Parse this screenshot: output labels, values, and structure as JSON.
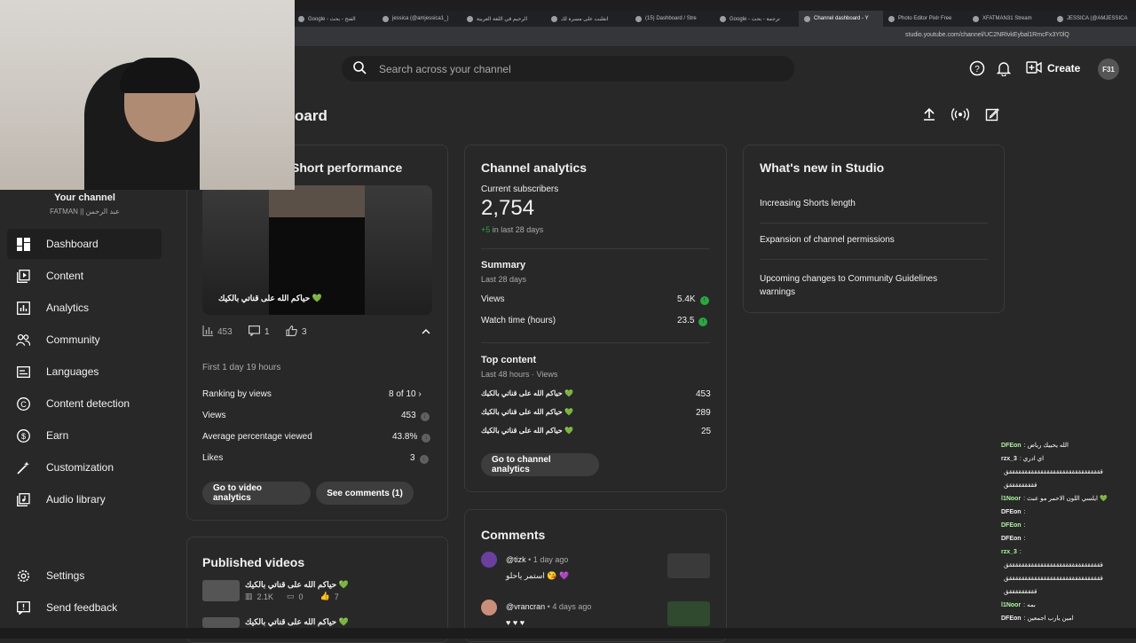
{
  "browser": {
    "tabs": [
      {
        "label": "Google - الفتح - بحث"
      },
      {
        "label": "jessica (@amjessica1_)"
      },
      {
        "label": "الرحيم في اللغة العربية"
      },
      {
        "label": "انقلبت على مسرة لك"
      },
      {
        "label": "(15) Dashboard / Stre"
      },
      {
        "label": "Google - ترجمة - بحث"
      },
      {
        "label": "Channel dashboard - Y",
        "active": true
      },
      {
        "label": "Photo Editor Pixlr Free"
      },
      {
        "label": "XFATMAN31 Stream"
      },
      {
        "label": "JESSICA (@AMJESSICA"
      }
    ],
    "url": "studio.youtube.com/channel/UC2NRlvkEybal1RmcFx3Y0lQ"
  },
  "header": {
    "search_placeholder": "Search across your channel",
    "create_label": "Create",
    "avatar_text": "F31",
    "page_title": "oard"
  },
  "sidebar": {
    "channel_label": "Your channel",
    "channel_name": "FATMAN || عبد الرحمن",
    "items": [
      {
        "label": "Dashboard",
        "icon": "dashboard-icon",
        "active": true
      },
      {
        "label": "Content",
        "icon": "content-icon"
      },
      {
        "label": "Analytics",
        "icon": "analytics-icon"
      },
      {
        "label": "Community",
        "icon": "community-icon"
      },
      {
        "label": "Languages",
        "icon": "languages-icon"
      },
      {
        "label": "Content detection",
        "icon": "content-detection-icon"
      },
      {
        "label": "Earn",
        "icon": "earn-icon"
      },
      {
        "label": "Customization",
        "icon": "customization-icon"
      },
      {
        "label": "Audio library",
        "icon": "audio-library-icon"
      }
    ],
    "settings_label": "Settings",
    "feedback_label": "Send feedback"
  },
  "short_card": {
    "title": "Short performance",
    "thumb_caption": "حياكم الله على قناتي بالكيك 💚",
    "views": "453",
    "comments": "1",
    "likes": "3",
    "first_label": "First 1 day 19 hours",
    "rows": [
      {
        "label": "Ranking by views",
        "value": "8 of 10"
      },
      {
        "label": "Views",
        "value": "453"
      },
      {
        "label": "Average percentage viewed",
        "value": "43.8%"
      },
      {
        "label": "Likes",
        "value": "3"
      }
    ],
    "btn_analytics": "Go to video analytics",
    "btn_comments": "See comments (1)"
  },
  "published": {
    "title": "Published videos",
    "videos": [
      {
        "title": "حياكم الله على قناتي بالكيك 💚",
        "views": "2.1K",
        "comments": "0",
        "likes": "7"
      },
      {
        "title": "حياكم الله على قناتي بالكيك 💚"
      }
    ]
  },
  "analytics_card": {
    "title": "Channel analytics",
    "subs_label": "Current subscribers",
    "subs_value": "2,754",
    "subs_change": "+5",
    "subs_change_suffix": " in last 28 days",
    "summary_title": "Summary",
    "summary_sub": "Last 28 days",
    "summary_rows": [
      {
        "label": "Views",
        "value": "5.4K"
      },
      {
        "label": "Watch time (hours)",
        "value": "23.5"
      }
    ],
    "top_title": "Top content",
    "top_sub": "Last 48 hours · Views",
    "top_rows": [
      {
        "title": "حياكم الله على قناتي بالكيك 💚",
        "value": "453"
      },
      {
        "title": "حياكم الله على قناتي بالكيك 💚",
        "value": "289"
      },
      {
        "title": "حياكم الله على قناتي بالكيك 💚",
        "value": "25"
      }
    ],
    "btn": "Go to channel analytics"
  },
  "comments_card": {
    "title": "Comments",
    "items": [
      {
        "user": "@tizk",
        "time": "• 1 day ago",
        "text": "استمر ياحلو 😘 💜"
      },
      {
        "user": "@vrancran",
        "time": "• 4 days ago",
        "text": "♥ ♥ ♥"
      }
    ]
  },
  "whats_new": {
    "title": "What's new in Studio",
    "items": [
      "Increasing Shorts length",
      "Expansion of channel permissions",
      "Upcoming changes to Community Guidelines warnings"
    ]
  },
  "chat": [
    {
      "name": "DFEon",
      "msg": ": الله يحييك رياض"
    },
    {
      "name": "rzx_3",
      "msg": ": اي ادري"
    },
    {
      "name": "",
      "msg": "ققققققققققققققققققققققققققققققق"
    },
    {
      "name": "",
      "msg": "قققققققققق"
    },
    {
      "name": "l1Noor",
      "msg": ": ايلسي اللون الاحمر مو عبث 💚"
    },
    {
      "name": "DFEon",
      "msg": ":"
    },
    {
      "name": "DFEon",
      "msg": ":"
    },
    {
      "name": "DFEon",
      "msg": ":"
    },
    {
      "name": "rzx_3",
      "msg": ":"
    },
    {
      "name": "",
      "msg": "ققققققققققققققققققققققققققققققق"
    },
    {
      "name": "",
      "msg": "ققققققققققققققققققققققققققققققق"
    },
    {
      "name": "",
      "msg": "قققققققققق"
    },
    {
      "name": "l1Noor",
      "msg": ": بمه"
    },
    {
      "name": "DFEon",
      "msg": ": امين يارب اجمعين"
    },
    {
      "name": "rzx_3",
      "msg": ":"
    }
  ],
  "colors": {
    "bg": "#282828",
    "up": "#2ba640",
    "accent": "#3ea6ff"
  }
}
